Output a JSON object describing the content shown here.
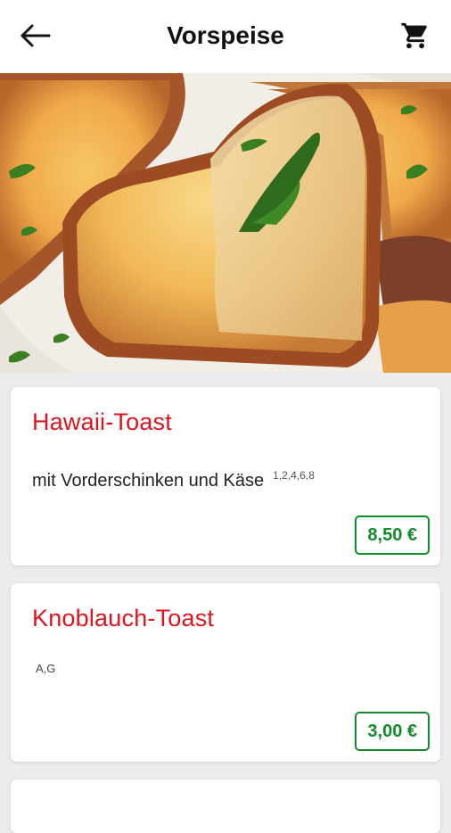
{
  "header": {
    "title": "Vorspeise",
    "back_icon": "arrow-back-icon",
    "cart_icon": "shopping-cart-icon"
  },
  "hero": {
    "image": "garlic-toast-photo"
  },
  "items": [
    {
      "name": "Hawaii-Toast",
      "description": "mit Vorderschinken und Käse",
      "additives": "1,2,4,6,8",
      "price": "8,50 €"
    },
    {
      "name": "Knoblauch-Toast",
      "description": "",
      "additives": "A,G",
      "price": "3,00 €"
    }
  ],
  "colors": {
    "item_name": "#e0141e",
    "price": "#138a2c",
    "background": "#ececec"
  }
}
